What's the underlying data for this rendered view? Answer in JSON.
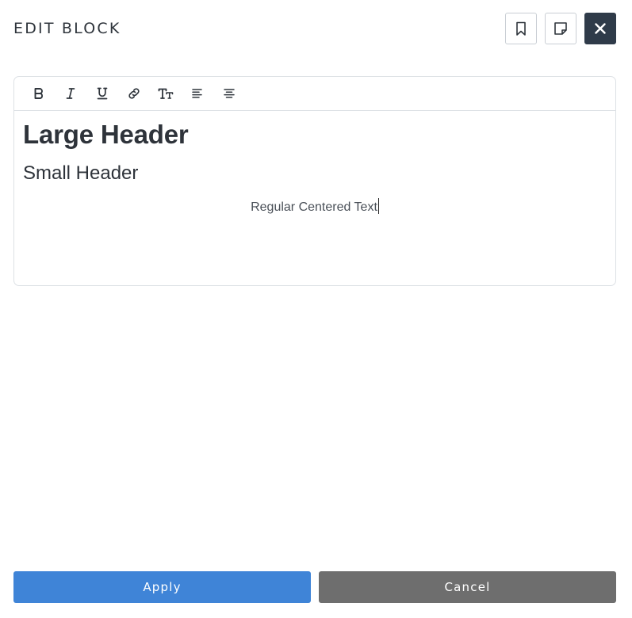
{
  "modal": {
    "title": "EDIT BLOCK"
  },
  "header_actions": [
    {
      "icon": "bookmark-icon"
    },
    {
      "icon": "sticky-note-icon"
    },
    {
      "icon": "close-icon"
    }
  ],
  "toolbar": {
    "items": [
      {
        "icon": "bold-icon"
      },
      {
        "icon": "italic-icon"
      },
      {
        "icon": "underline-icon"
      },
      {
        "icon": "link-icon"
      },
      {
        "icon": "text-size-icon"
      },
      {
        "icon": "align-left-icon"
      },
      {
        "icon": "align-center-icon"
      }
    ]
  },
  "editor": {
    "large_header": "Large Header",
    "small_header": "Small Header",
    "centered_text": "Regular Centered Text"
  },
  "footer": {
    "apply_label": "Apply",
    "cancel_label": "Cancel"
  },
  "colors": {
    "apply": "#3f84d7",
    "cancel": "#6e6e6e",
    "close_button": "#2f3b49"
  }
}
